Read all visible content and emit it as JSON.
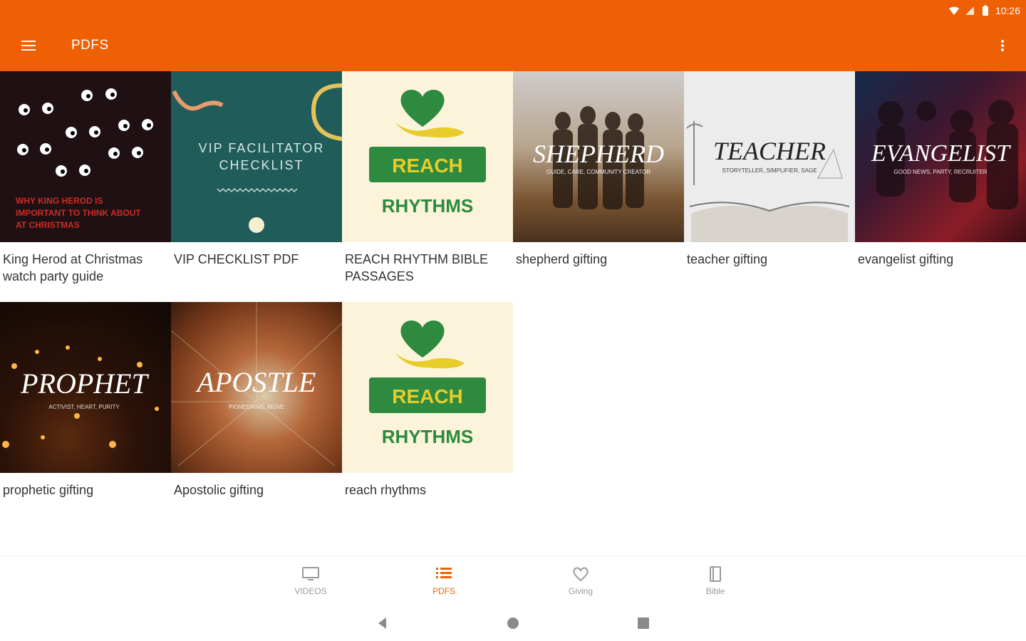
{
  "status": {
    "time": "10:26",
    "icons": [
      "wifi-icon",
      "signal-icon",
      "battery-icon"
    ]
  },
  "appbar": {
    "title": "PDFS",
    "menu_icon": "hamburger-menu-icon",
    "overflow_icon": "more-vert-icon",
    "color": "#ef6004"
  },
  "items": [
    {
      "caption": "King Herod at Christmas watch party guide",
      "thumb_lines": [
        "WHY KING HEROD IS",
        "IMPORTANT TO THINK ABOUT",
        "AT CHRISTMAS"
      ]
    },
    {
      "caption": "VIP CHECKLIST PDF",
      "thumb_lines": [
        "VIP FACILITATOR",
        "CHECKLIST"
      ]
    },
    {
      "caption": "REACH RHYTHM BIBLE PASSAGES",
      "thumb_lines": [
        "REACH",
        "RHYTHMS"
      ]
    },
    {
      "caption": "shepherd gifting",
      "thumb_lines": [
        "SHEPHERD",
        "GUIDE, CARE, COMMUNITY CREATOR"
      ]
    },
    {
      "caption": "teacher gifting",
      "thumb_lines": [
        "TEACHER",
        "STORYTELLER, SIMPLIFIER, SAGE"
      ]
    },
    {
      "caption": "evangelist gifting",
      "thumb_lines": [
        "EVANGELIST",
        "GOOD NEWS, PARTY, RECRUITER"
      ]
    },
    {
      "caption": "prophetic gifting",
      "thumb_lines": [
        "PROPHET",
        "ACTIVIST, HEART, PURITY"
      ]
    },
    {
      "caption": "Apostolic gifting",
      "thumb_lines": [
        "APOSTLE",
        "PIONEERING, MOVE"
      ]
    },
    {
      "caption": "reach rhythms",
      "thumb_lines": [
        "REACH",
        "RHYTHMS"
      ]
    }
  ],
  "bottom_nav": [
    {
      "label": "VIDEOS",
      "icon": "monitor-icon",
      "active": false
    },
    {
      "label": "PDFS",
      "icon": "list-icon",
      "active": true
    },
    {
      "label": "Giving",
      "icon": "heart-icon",
      "active": false
    },
    {
      "label": "Bible",
      "icon": "book-icon",
      "active": false
    }
  ],
  "system_nav": [
    "back-icon",
    "home-icon",
    "recents-icon"
  ]
}
